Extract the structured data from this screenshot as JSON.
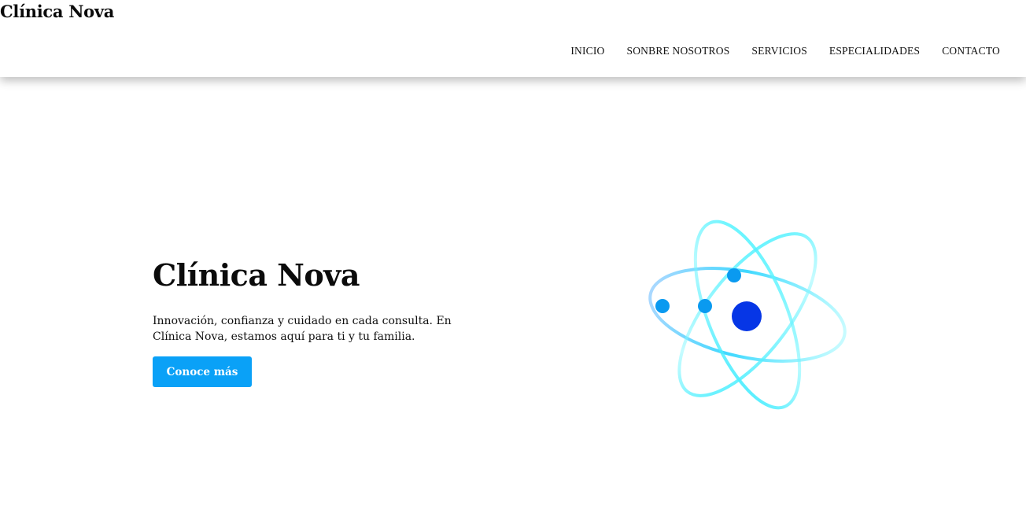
{
  "header": {
    "brand": "Clínica Nova",
    "nav": [
      {
        "label": "INICIO"
      },
      {
        "label": "SONBRE NOSOTROS"
      },
      {
        "label": "SERVICIOS"
      },
      {
        "label": "ESPECIALIDADES"
      },
      {
        "label": "CONTACTO"
      }
    ]
  },
  "hero": {
    "title": "Clínica Nova",
    "text": "Innovación, confianza y cuidado en cada consulta. En Clínica Nova, estamos aquí para ti y tu familia.",
    "cta_label": "Conoce más"
  },
  "illustration": {
    "icon": "atom-icon",
    "colors": {
      "orbit": "#3ff0ff",
      "electron": "#0a9af0",
      "nucleus": "#0636e6",
      "button": "#0aa1f7"
    }
  }
}
